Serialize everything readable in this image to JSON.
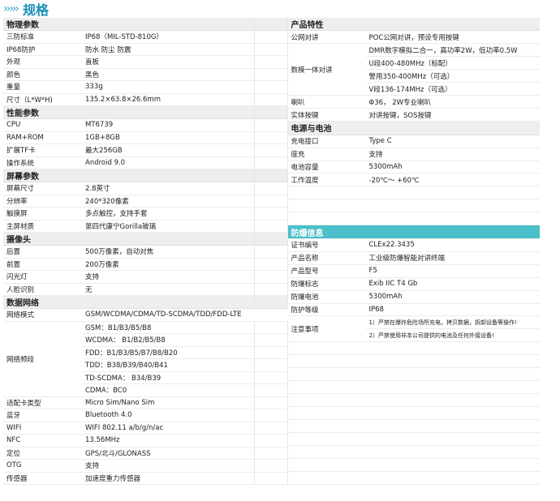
{
  "header": {
    "arrows": "›››››",
    "title": "规格"
  },
  "left": {
    "sections": [
      {
        "title": "物理参数",
        "rows": [
          [
            "三防标准",
            "IP68（MIL-STD-810G）"
          ],
          [
            "IP68防护",
            "防水  防尘  防震"
          ],
          [
            "外观",
            "直板"
          ],
          [
            "颜色",
            "黑色"
          ],
          [
            "重量",
            "333g"
          ],
          [
            "尺寸（L*W*H)",
            "135.2×63.8×26.6mm"
          ]
        ]
      },
      {
        "title": "性能参数",
        "rows": [
          [
            "CPU",
            "MT6739"
          ],
          [
            "RAM+ROM",
            "1GB+8GB"
          ],
          [
            "扩展TF卡",
            "最大256GB"
          ],
          [
            "操作系统",
            "Android 9.0"
          ]
        ]
      },
      {
        "title": "屏幕参数",
        "rows": [
          [
            "屏幕尺寸",
            "2.8英寸"
          ],
          [
            "分辨率",
            "240*320像素"
          ],
          [
            "触摸屏",
            "多点触控，支持手套"
          ],
          [
            "主屏材质",
            "第四代康宁Gorilla玻璃"
          ]
        ]
      },
      {
        "title": "摄像头",
        "rows": [
          [
            "后置",
            "500万像素，自动对焦"
          ],
          [
            "前置",
            "200万像素"
          ],
          [
            "闪光灯",
            "支持"
          ],
          [
            "人脸识别",
            "无"
          ]
        ]
      },
      {
        "title": "数据网络",
        "rows": [
          [
            "网络模式",
            "GSM/WCDMA/CDMA/TD-SCDMA/TDD/FDD-LTE"
          ]
        ]
      }
    ],
    "bands_label": "网络频段",
    "bands": [
      "GSM：B1/B3/B5/B8",
      "WCDMA： B1/B2/B5/B8",
      "FDD：B1/B3/B5/B7/B8/B20",
      "TDD：B38/B39/B40/B41",
      "TD-SCDMA： B34/B39",
      "CDMA：BC0"
    ],
    "tail_rows": [
      [
        "适配卡类型",
        "Micro Sim/Nano Sim"
      ],
      [
        "蓝牙",
        "Bluetooth 4.0"
      ],
      [
        "WIFI",
        "WIFI 802.11 a/b/g/n/ac"
      ],
      [
        "NFC",
        "13.56MHz"
      ],
      [
        "定位",
        "GPS/北斗/GLONASS"
      ],
      [
        "OTG",
        "支持"
      ],
      [
        "传感器",
        "加速度重力传感器"
      ]
    ]
  },
  "right": {
    "product": {
      "title": "产品特性",
      "poc": [
        "公网对讲",
        "POC公网对讲，预设专用按键"
      ],
      "dmr_label": "数模一体对讲",
      "dmr_values": [
        "DMR数字模拟二合一，高功率2W，低功率0.5W",
        "U段400-480MHz（标配）",
        "警用350-400MHz（可选）",
        "V段136-174MHz（可选）"
      ],
      "rows": [
        [
          "喇叭",
          "Φ36，  2W专业喇叭"
        ],
        [
          "实体按键",
          "对讲按键，SOS按键"
        ]
      ]
    },
    "power": {
      "title": "电源与电池",
      "rows": [
        [
          "充电接口",
          "Type C"
        ],
        [
          "座充",
          "支持"
        ],
        [
          "电池容量",
          "5300mAh"
        ],
        [
          "工作温度",
          "-20℃～ +60℃"
        ]
      ]
    },
    "explosion": {
      "title": "防爆信息",
      "rows": [
        [
          "证书编号",
          "CLEx22.3435"
        ],
        [
          "产品名称",
          "工业级防爆智能对讲终端"
        ],
        [
          "产品型号",
          "F5"
        ],
        [
          "防爆标志",
          "Exib IIC T4 Gb"
        ],
        [
          "防爆电池",
          "5300mAh"
        ],
        [
          "防护等级",
          "IP68"
        ]
      ],
      "notes_label": "注意事项",
      "notes": [
        "1）严禁在爆炸危险场所充电，拷贝数据，拆卸设备等操作!",
        "2）严禁使用非本公司提供的电池及任何外接设备!"
      ]
    }
  }
}
